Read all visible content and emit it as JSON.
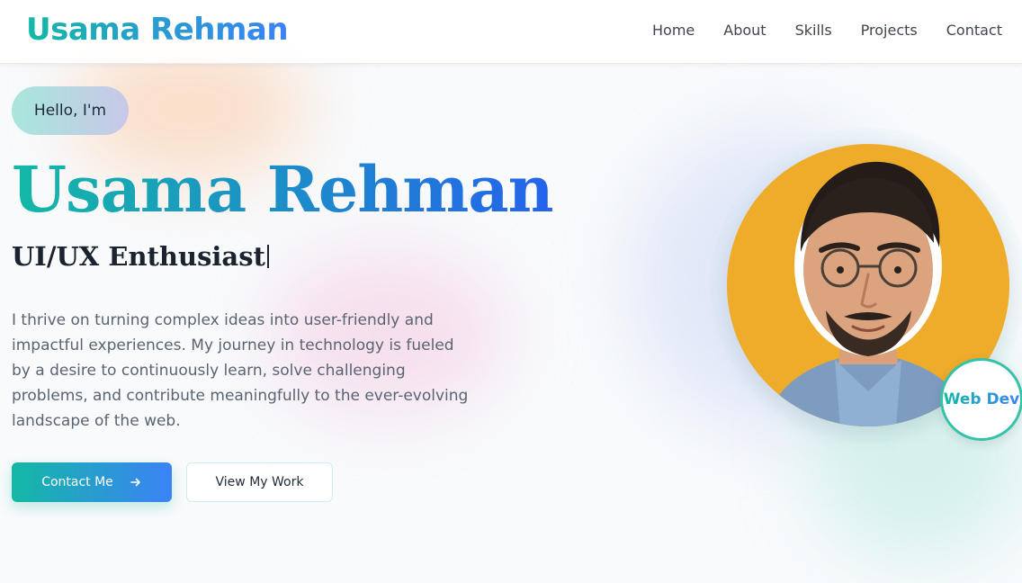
{
  "header": {
    "logo": "Usama Rehman",
    "nav": [
      {
        "label": "Home"
      },
      {
        "label": "About"
      },
      {
        "label": "Skills"
      },
      {
        "label": "Projects"
      },
      {
        "label": "Contact"
      }
    ]
  },
  "hero": {
    "greeting": "Hello, I'm",
    "name": "Usama Rehman",
    "role": "UI/UX Enthusiast",
    "description": "I thrive on turning complex ideas into user-friendly and impactful experiences. My journey in technology is fueled by a desire to continuously learn, solve challenging problems, and contribute meaningfully to the ever-evolving landscape of the web.",
    "primary_button": {
      "label": "Contact Me",
      "icon": "arrow-right-icon"
    },
    "secondary_button": {
      "label": "View My Work"
    }
  },
  "profile": {
    "image": "profile-photo",
    "badge": "Web Dev"
  },
  "colors": {
    "accent_start": "#14b8a6",
    "accent_end": "#3b82f6",
    "profile_bg": "#eeac2a",
    "text_dark": "#1b2230",
    "text_muted": "#5a6470"
  }
}
